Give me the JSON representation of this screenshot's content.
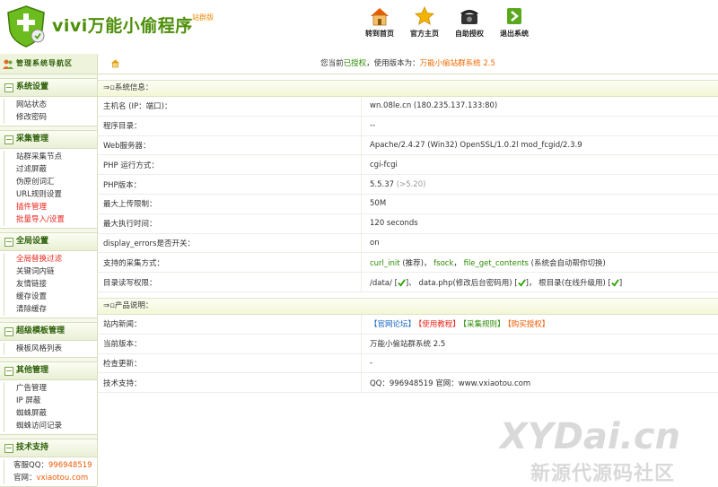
{
  "header": {
    "title": "vivi万能小偷程序",
    "subtitle": "站群版",
    "nav": [
      {
        "label": "转到首页",
        "icon": "home-icon"
      },
      {
        "label": "官方主页",
        "icon": "star-icon"
      },
      {
        "label": "自助授权",
        "icon": "phone-icon"
      },
      {
        "label": "退出系统",
        "icon": "exit-icon"
      }
    ]
  },
  "sidebar": {
    "title": "管理系统导航区",
    "groups": [
      {
        "label": "系统设置",
        "items": [
          "网站状态",
          "修改密码"
        ]
      },
      {
        "label": "采集管理",
        "items": [
          "站群采集节点",
          "过滤屏蔽",
          "伪原创词汇",
          "URL规则设置",
          "插件管理",
          "批量导入/设置"
        ]
      },
      {
        "label": "全局设置",
        "items": [
          "全局替换过滤",
          "关键词内链",
          "友情链接",
          "缓存设置",
          "清除缓存"
        ]
      },
      {
        "label": "超级模板管理",
        "items": [
          "模板风格列表"
        ]
      },
      {
        "label": "其他管理",
        "items": [
          "广告管理",
          "IP 屏蔽",
          "蜘蛛屏蔽",
          "蜘蛛访问记录"
        ]
      },
      {
        "label": "技术支持",
        "items": []
      }
    ],
    "support": {
      "qq_label": "客服QQ：",
      "qq_value": "996948519",
      "site_label": "官网：",
      "site_value": "vxiaotou.com"
    }
  },
  "status": {
    "prefix": "您当前",
    "auth": "已授权",
    "mid": "，使用版本为：",
    "version": "万能小偷站群系统 2.5"
  },
  "system_info": {
    "heading": "系统信息：",
    "rows": [
      {
        "key": "主机名 (IP：端口)：",
        "value": "wn.08le.cn  (180.235.137.133:80)"
      },
      {
        "key": "程序目录：",
        "value": "--"
      },
      {
        "key": "Web服务器：",
        "value": "Apache/2.4.27 (Win32) OpenSSL/1.0.2l mod_fcgid/2.3.9"
      },
      {
        "key": "PHP 运行方式：",
        "value": "cgi-fcgi"
      },
      {
        "key": "PHP版本：",
        "value": "5.5.37",
        "hint": "(>5.20)"
      },
      {
        "key": "最大上传限制：",
        "value": "50M"
      },
      {
        "key": "最大执行时间：",
        "value": "120 seconds"
      },
      {
        "key": "display_errors是否开关：",
        "value": "on"
      }
    ],
    "methods_key": "支持的采集方式：",
    "methods": {
      "m1": "curl_init",
      "m1_note": "(推荐)",
      "m2": "fsock",
      "m3": "file_get_contents",
      "note": "(系统会自动帮你切换)"
    },
    "perm_key": "目录读写权限：",
    "perm": {
      "p1": "/data/",
      "p2": "data.php(修改后台密码用)",
      "p3": "根目录(在线升级用)"
    }
  },
  "product_info": {
    "heading": "产品说明：",
    "news_key": "站内新闻：",
    "links": [
      "【官网论坛】",
      "【使用教程】",
      "【采集规则】",
      "【购买授权】"
    ],
    "rows": [
      {
        "key": "当前版本：",
        "value": "万能小偷站群系统 2.5"
      },
      {
        "key": "检查更新：",
        "value": "-"
      },
      {
        "key": "技术支持：",
        "value": "QQ：996948519    官网：www.vxiaotou.com"
      }
    ]
  },
  "watermark": {
    "line1": "XYDai.cn",
    "line2": "新源代源码社区"
  }
}
